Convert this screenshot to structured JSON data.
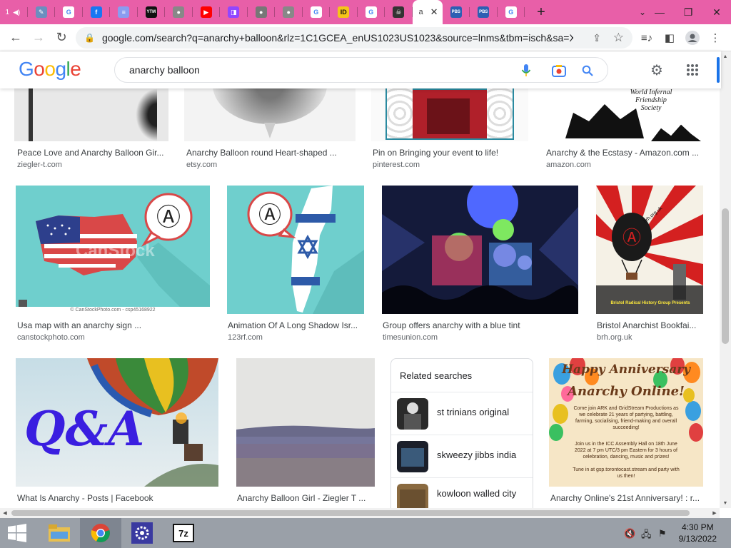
{
  "browser": {
    "tabs": [
      {
        "name": "tab-1",
        "label": "1",
        "icon": "speaker-icon",
        "color": "#e85fa8",
        "glyph": "◀)"
      },
      {
        "name": "tab-2",
        "label": "",
        "icon": "edit-icon",
        "color": "#6c8ebf",
        "glyph": "✎"
      },
      {
        "name": "tab-3",
        "label": "",
        "icon": "google-icon",
        "color": "#ffffff",
        "glyph": "G"
      },
      {
        "name": "tab-4",
        "label": "",
        "icon": "facebook-icon",
        "color": "#1877f2",
        "glyph": "f"
      },
      {
        "name": "tab-5",
        "label": "",
        "icon": "page-icon",
        "color": "#8a9cf0",
        "glyph": "≡"
      },
      {
        "name": "tab-6",
        "label": "",
        "icon": "ytm-icon",
        "color": "#111111",
        "glyph": "YTM"
      },
      {
        "name": "tab-7",
        "label": "",
        "icon": "globe-icon",
        "color": "#888888",
        "glyph": "●"
      },
      {
        "name": "tab-8",
        "label": "",
        "icon": "youtube-icon",
        "color": "#ff0000",
        "glyph": "▶"
      },
      {
        "name": "tab-9",
        "label": "",
        "icon": "twitch-icon",
        "color": "#9146ff",
        "glyph": "◨"
      },
      {
        "name": "tab-10",
        "label": "",
        "icon": "globe-icon",
        "color": "#777777",
        "glyph": "●"
      },
      {
        "name": "tab-11",
        "label": "",
        "icon": "globe-icon",
        "color": "#888888",
        "glyph": "●"
      },
      {
        "name": "tab-12",
        "label": "",
        "icon": "google-icon",
        "color": "#ffffff",
        "glyph": "G"
      },
      {
        "name": "tab-13",
        "label": "",
        "icon": "imdb-icon",
        "color": "#f5c518",
        "glyph": "ID"
      },
      {
        "name": "tab-14",
        "label": "",
        "icon": "google-icon",
        "color": "#ffffff",
        "glyph": "G"
      },
      {
        "name": "tab-15",
        "label": "",
        "icon": "skull-icon",
        "color": "#333333",
        "glyph": "☠"
      }
    ],
    "active_tab": {
      "label": "a",
      "close": "✕"
    },
    "after_tabs": [
      {
        "name": "tab-17",
        "icon": "pbs-icon",
        "color": "#2d5fb3",
        "glyph": "PBS"
      },
      {
        "name": "tab-18",
        "icon": "pbs-icon",
        "color": "#2d5fb3",
        "glyph": "PBS"
      },
      {
        "name": "tab-19",
        "icon": "google-icon",
        "color": "#ffffff",
        "glyph": "G"
      }
    ],
    "new_tab": "+",
    "url": "google.com/search?q=anarchy+balloon&rlz=1C1GCEA_enUS1023US1023&source=lnms&tbm=isch&sa=X..."
  },
  "google": {
    "logo_letters": [
      {
        "ch": "G",
        "color": "#4285f4"
      },
      {
        "ch": "o",
        "color": "#ea4335"
      },
      {
        "ch": "o",
        "color": "#fbbc05"
      },
      {
        "ch": "g",
        "color": "#4285f4"
      },
      {
        "ch": "l",
        "color": "#34a853"
      },
      {
        "ch": "e",
        "color": "#ea4335"
      }
    ],
    "query": "anarchy balloon"
  },
  "results_row1": [
    {
      "caption": "Peace Love and Anarchy Balloon Gir...",
      "source": "ziegler-t.com"
    },
    {
      "caption": "Anarchy Balloon round Heart-shaped ...",
      "source": "etsy.com"
    },
    {
      "caption": "Pin on Bringing your event to life!",
      "source": "pinterest.com"
    },
    {
      "caption": "Anarchy & the Ecstasy - Amazon.com ...",
      "source": "amazon.com"
    }
  ],
  "results_row2": [
    {
      "caption": "Usa map with an anarchy sign ...",
      "source": "canstockphoto.com",
      "watermark": "© CanStockPhoto.com - csp45168922",
      "overlay": "CanStock"
    },
    {
      "caption": "Animation Of A Long Shadow Isr...",
      "source": "123rf.com"
    },
    {
      "caption": "Group offers anarchy with a blue tint",
      "source": "timesunion.com"
    },
    {
      "caption": "Bristol Anarchist Bookfai...",
      "source": "brh.org.uk",
      "poster_url": "brh.org.uk",
      "poster_lines": [
        "Bristol",
        "Radical",
        "History",
        "Group",
        "Presents"
      ]
    }
  ],
  "results_row3": [
    {
      "caption": "What Is Anarchy - Posts | Facebook",
      "big_text": "Q&A"
    },
    {
      "caption": "Anarchy Balloon Girl - Ziegler T ..."
    },
    {
      "caption": "Anarchy Online's 21st Anniversary! : r...",
      "poster_title_1": "Happy Anniversary",
      "poster_title_2": "Anarchy Online!",
      "poster_body_1": "Come join ARK and GridStream Productions as we celebrate 21 years of partying, battling, farming, socialising, friend-making and overall succeeding!",
      "poster_body_2": "Join us in the ICC Assembly Hall on 18th June 2022 at 7 pm UTC/3 pm Eastern for 3 hours of celebration, dancing, music and prizes!",
      "poster_body_3": "Tune in at gsp.torontocast.stream and party with us then!"
    }
  ],
  "related": {
    "title": "Related searches",
    "items": [
      {
        "label": "st trinians original"
      },
      {
        "label": "skweezy jibbs india"
      },
      {
        "label": "kowloon walled city"
      }
    ]
  },
  "taskbar": {
    "time": "4:30 PM",
    "date": "9/13/2022",
    "sevenzip": "7z"
  }
}
